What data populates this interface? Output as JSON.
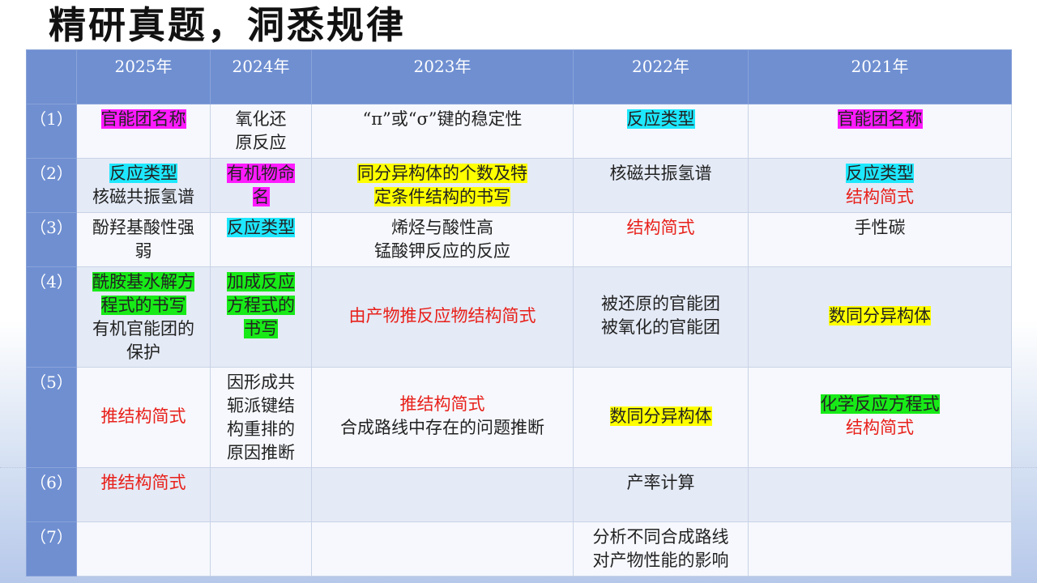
{
  "title": "精研真题，洞悉规律",
  "years": [
    "2025年",
    "2024年",
    "2023年",
    "2022年",
    "2021年"
  ],
  "rows": [
    {
      "label": "（1）",
      "cells": [
        [
          {
            "text": "官能团名称",
            "hl": "m"
          }
        ],
        [
          {
            "text": "氧化还"
          },
          {
            "text": "原反应"
          }
        ],
        [
          {
            "text": "“π”或“σ”键的稳定性"
          }
        ],
        [
          {
            "text": "反应类型",
            "hl": "c"
          }
        ],
        [
          {
            "text": "官能团名称",
            "hl": "m"
          }
        ]
      ]
    },
    {
      "label": "（2）",
      "cells": [
        [
          {
            "text": "反应类型",
            "hl": "c"
          },
          {
            "text": "核磁共振氢谱"
          }
        ],
        [
          {
            "text": "有机物命",
            "hl": "m"
          },
          {
            "text": "名",
            "hl": "m"
          }
        ],
        [
          {
            "text": "同分异构体的个数及特",
            "hl": "y"
          },
          {
            "text": "定条件结构的书写",
            "hl": "y"
          }
        ],
        [
          {
            "text": "核磁共振氢谱"
          }
        ],
        [
          {
            "text": "反应类型",
            "hl": "c"
          },
          {
            "text": "结构简式",
            "red": true
          }
        ]
      ]
    },
    {
      "label": "（3）",
      "cells": [
        [
          {
            "text": "酚羟基酸性强"
          },
          {
            "text": "弱"
          }
        ],
        [
          {
            "text": "反应类型",
            "hl": "c"
          }
        ],
        [
          {
            "text": "烯烃与酸性高"
          },
          {
            "text": "锰酸钾反应的反应"
          }
        ],
        [
          {
            "text": "结构简式",
            "red": true
          }
        ],
        [
          {
            "text": "手性碳"
          }
        ]
      ]
    },
    {
      "label": "（4）",
      "cells": [
        [
          {
            "text": "酰胺基水解方",
            "hl": "g"
          },
          {
            "text": "程式的书写",
            "hl": "g"
          },
          {
            "text": "有机官能团的"
          },
          {
            "text": "保护"
          }
        ],
        [
          {
            "text": "加成反应",
            "hl": "g"
          },
          {
            "text": "方程式的",
            "hl": "g"
          },
          {
            "text": "书写",
            "hl": "g"
          }
        ],
        [
          {
            "text": "由产物推反应物结构简式",
            "red": true
          }
        ],
        [
          {
            "text": "被还原的官能团"
          },
          {
            "text": "被氧化的官能团"
          }
        ],
        [
          {
            "text": "数同分异构体",
            "hl": "y"
          }
        ]
      ]
    },
    {
      "label": "（5）",
      "cells": [
        [
          {
            "text": "推结构简式",
            "red": true
          }
        ],
        [
          {
            "text": "因形成共"
          },
          {
            "text": "轭派键结"
          },
          {
            "text": "构重排的"
          },
          {
            "text": "原因推断"
          }
        ],
        [
          {
            "text": "推结构简式",
            "red": true
          },
          {
            "text": "合成路线中存在的问题推断"
          }
        ],
        [
          {
            "text": "数同分异构体",
            "hl": "y"
          }
        ],
        [
          {
            "text": "化学反应方程式",
            "hl": "g"
          },
          {
            "text": "结构简式",
            "red": true
          }
        ]
      ]
    },
    {
      "label": "（6）",
      "cells": [
        [
          {
            "text": "推结构简式",
            "red": true
          }
        ],
        [],
        [],
        [
          {
            "text": "产率计算"
          }
        ],
        []
      ]
    },
    {
      "label": "（7）",
      "cells": [
        [],
        [],
        [],
        [
          {
            "text": "分析不同合成路线"
          },
          {
            "text": "对产物性能的影响"
          }
        ],
        []
      ]
    }
  ]
}
